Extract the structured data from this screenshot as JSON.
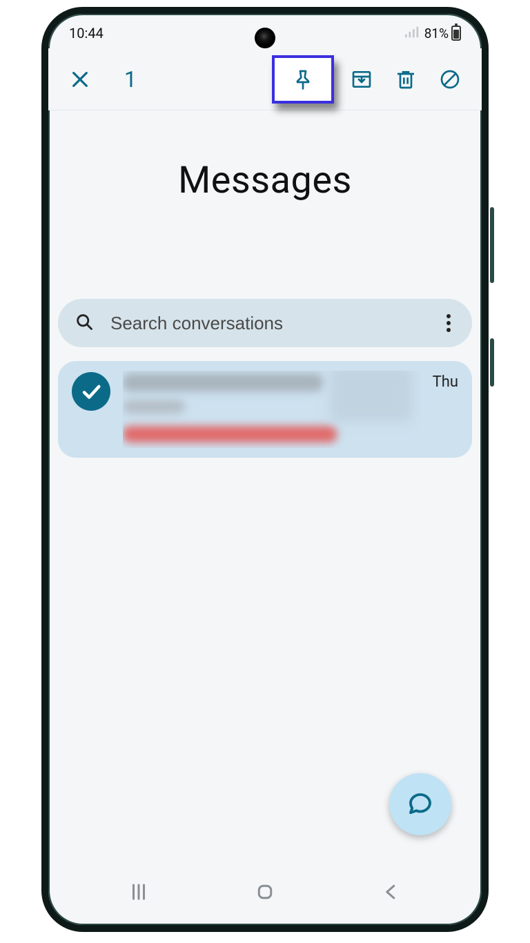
{
  "status": {
    "time": "10:44",
    "battery_pct": "81%"
  },
  "action_bar": {
    "selected_count": "1"
  },
  "page": {
    "title": "Messages"
  },
  "search": {
    "placeholder": "Search conversations"
  },
  "conversations": [
    {
      "day": "Thu"
    }
  ],
  "colors": {
    "accent": "#0b6a88",
    "highlight_border": "#3b2fe0",
    "pill_bg": "#d6e3ea",
    "row_bg": "#cde1ef",
    "fab_bg": "#bfe2f5"
  },
  "icons": {
    "close": "close-icon",
    "pin": "pin-icon",
    "archive": "archive-icon",
    "delete": "trash-icon",
    "block": "block-icon",
    "search": "search-icon",
    "more": "more-vertical-icon",
    "check": "check-icon",
    "compose": "compose-icon",
    "nav_recent": "recent-apps-icon",
    "nav_home": "home-icon",
    "nav_back": "back-icon",
    "signal": "signal-icon",
    "battery": "battery-icon"
  }
}
